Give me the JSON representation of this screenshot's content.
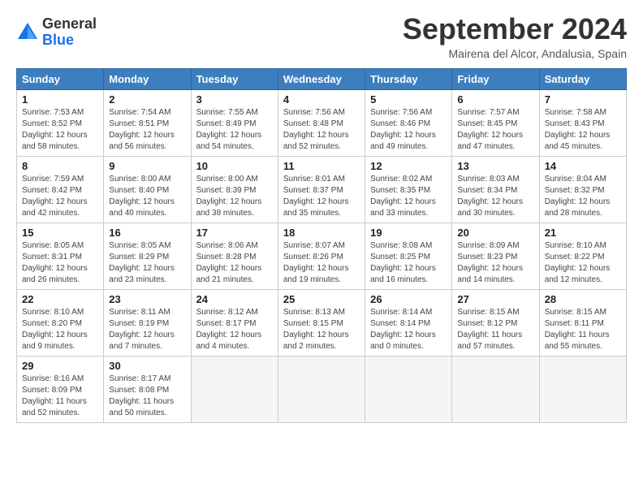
{
  "header": {
    "logo_general": "General",
    "logo_blue": "Blue",
    "month_title": "September 2024",
    "location": "Mairena del Alcor, Andalusia, Spain"
  },
  "columns": [
    "Sunday",
    "Monday",
    "Tuesday",
    "Wednesday",
    "Thursday",
    "Friday",
    "Saturday"
  ],
  "weeks": [
    [
      {
        "day": "1",
        "rise": "7:53 AM",
        "set": "8:52 PM",
        "daylight": "12 hours and 58 minutes."
      },
      {
        "day": "2",
        "rise": "7:54 AM",
        "set": "8:51 PM",
        "daylight": "12 hours and 56 minutes."
      },
      {
        "day": "3",
        "rise": "7:55 AM",
        "set": "8:49 PM",
        "daylight": "12 hours and 54 minutes."
      },
      {
        "day": "4",
        "rise": "7:56 AM",
        "set": "8:48 PM",
        "daylight": "12 hours and 52 minutes."
      },
      {
        "day": "5",
        "rise": "7:56 AM",
        "set": "8:46 PM",
        "daylight": "12 hours and 49 minutes."
      },
      {
        "day": "6",
        "rise": "7:57 AM",
        "set": "8:45 PM",
        "daylight": "12 hours and 47 minutes."
      },
      {
        "day": "7",
        "rise": "7:58 AM",
        "set": "8:43 PM",
        "daylight": "12 hours and 45 minutes."
      }
    ],
    [
      {
        "day": "8",
        "rise": "7:59 AM",
        "set": "8:42 PM",
        "daylight": "12 hours and 42 minutes."
      },
      {
        "day": "9",
        "rise": "8:00 AM",
        "set": "8:40 PM",
        "daylight": "12 hours and 40 minutes."
      },
      {
        "day": "10",
        "rise": "8:00 AM",
        "set": "8:39 PM",
        "daylight": "12 hours and 38 minutes."
      },
      {
        "day": "11",
        "rise": "8:01 AM",
        "set": "8:37 PM",
        "daylight": "12 hours and 35 minutes."
      },
      {
        "day": "12",
        "rise": "8:02 AM",
        "set": "8:35 PM",
        "daylight": "12 hours and 33 minutes."
      },
      {
        "day": "13",
        "rise": "8:03 AM",
        "set": "8:34 PM",
        "daylight": "12 hours and 30 minutes."
      },
      {
        "day": "14",
        "rise": "8:04 AM",
        "set": "8:32 PM",
        "daylight": "12 hours and 28 minutes."
      }
    ],
    [
      {
        "day": "15",
        "rise": "8:05 AM",
        "set": "8:31 PM",
        "daylight": "12 hours and 26 minutes."
      },
      {
        "day": "16",
        "rise": "8:05 AM",
        "set": "8:29 PM",
        "daylight": "12 hours and 23 minutes."
      },
      {
        "day": "17",
        "rise": "8:06 AM",
        "set": "8:28 PM",
        "daylight": "12 hours and 21 minutes."
      },
      {
        "day": "18",
        "rise": "8:07 AM",
        "set": "8:26 PM",
        "daylight": "12 hours and 19 minutes."
      },
      {
        "day": "19",
        "rise": "8:08 AM",
        "set": "8:25 PM",
        "daylight": "12 hours and 16 minutes."
      },
      {
        "day": "20",
        "rise": "8:09 AM",
        "set": "8:23 PM",
        "daylight": "12 hours and 14 minutes."
      },
      {
        "day": "21",
        "rise": "8:10 AM",
        "set": "8:22 PM",
        "daylight": "12 hours and 12 minutes."
      }
    ],
    [
      {
        "day": "22",
        "rise": "8:10 AM",
        "set": "8:20 PM",
        "daylight": "12 hours and 9 minutes."
      },
      {
        "day": "23",
        "rise": "8:11 AM",
        "set": "8:19 PM",
        "daylight": "12 hours and 7 minutes."
      },
      {
        "day": "24",
        "rise": "8:12 AM",
        "set": "8:17 PM",
        "daylight": "12 hours and 4 minutes."
      },
      {
        "day": "25",
        "rise": "8:13 AM",
        "set": "8:15 PM",
        "daylight": "12 hours and 2 minutes."
      },
      {
        "day": "26",
        "rise": "8:14 AM",
        "set": "8:14 PM",
        "daylight": "12 hours and 0 minutes."
      },
      {
        "day": "27",
        "rise": "8:15 AM",
        "set": "8:12 PM",
        "daylight": "11 hours and 57 minutes."
      },
      {
        "day": "28",
        "rise": "8:15 AM",
        "set": "8:11 PM",
        "daylight": "11 hours and 55 minutes."
      }
    ],
    [
      {
        "day": "29",
        "rise": "8:16 AM",
        "set": "8:09 PM",
        "daylight": "11 hours and 52 minutes."
      },
      {
        "day": "30",
        "rise": "8:17 AM",
        "set": "8:08 PM",
        "daylight": "11 hours and 50 minutes."
      },
      null,
      null,
      null,
      null,
      null
    ]
  ]
}
